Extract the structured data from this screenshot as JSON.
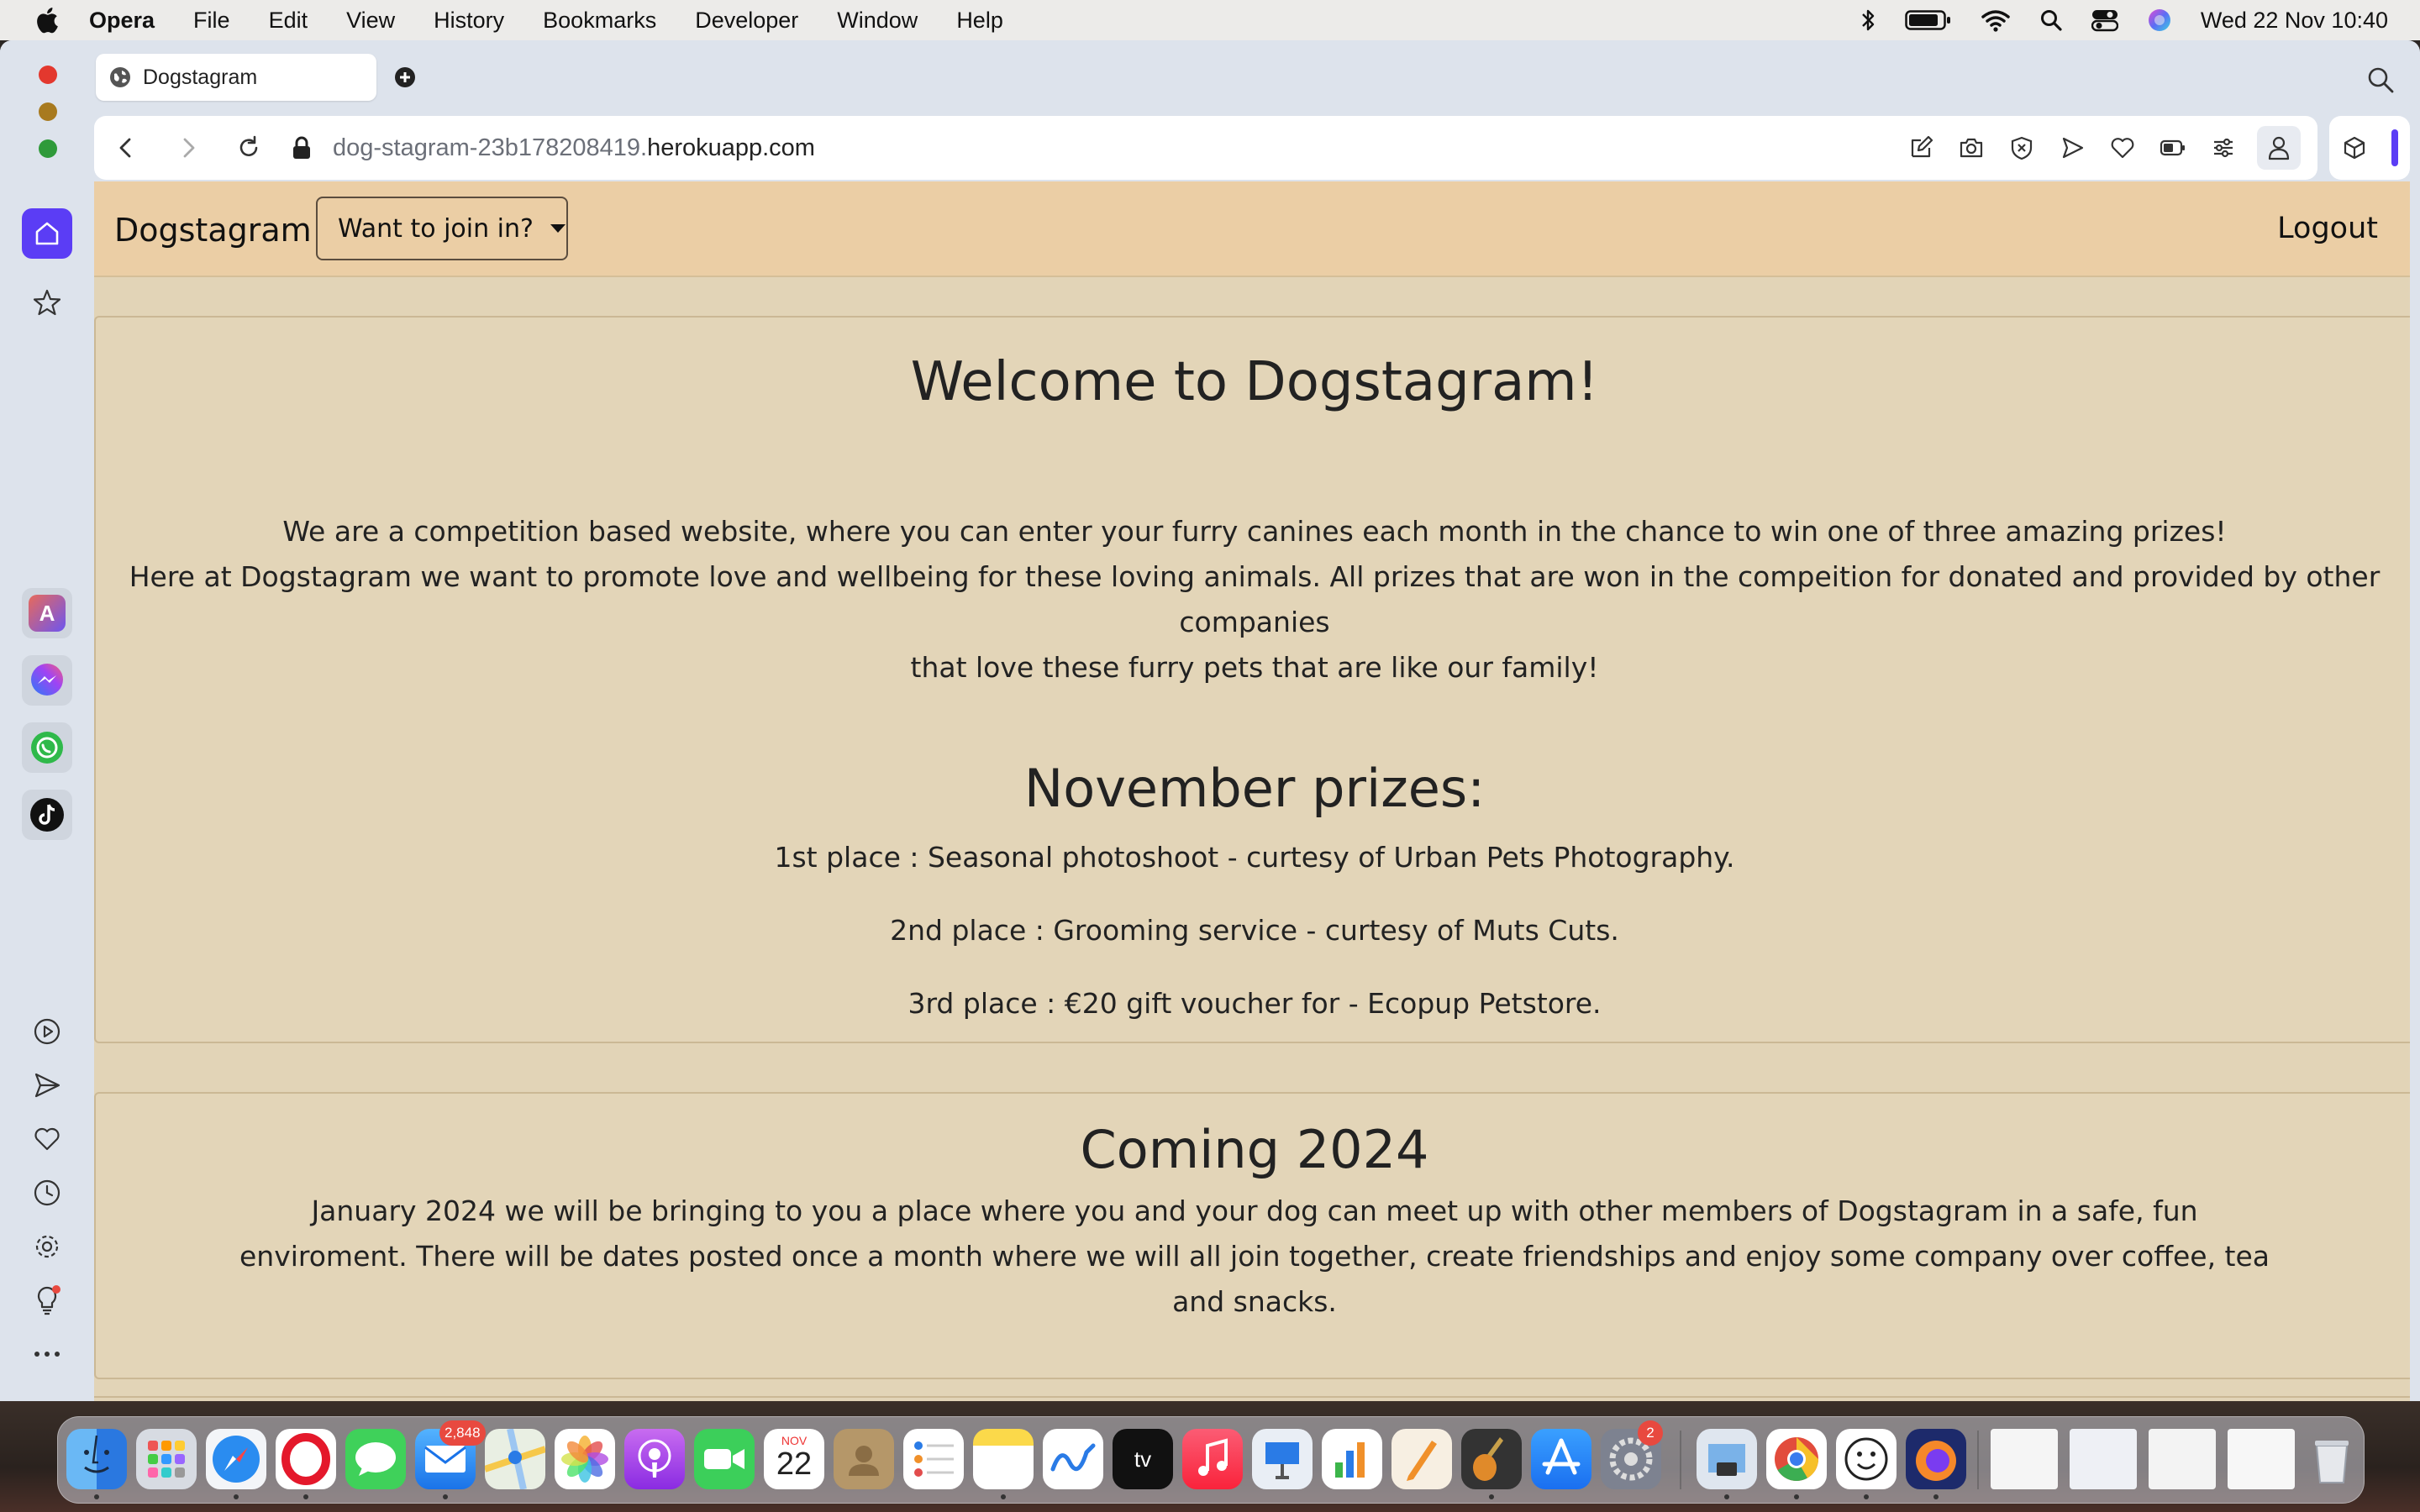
{
  "menubar": {
    "app_name": "Opera",
    "items": [
      "File",
      "Edit",
      "View",
      "History",
      "Bookmarks",
      "Developer",
      "Window",
      "Help"
    ],
    "clock": "Wed 22 Nov  10:40",
    "status_icons": [
      "bluetooth-icon",
      "battery-icon",
      "wifi-icon",
      "spotlight-icon",
      "control-center-icon",
      "siri-icon"
    ]
  },
  "browser": {
    "tab": {
      "title": "Dogstagram"
    },
    "address": {
      "url_prefix": "dog-stagram-23b178208419.",
      "url_domain": "herokuapp.com"
    },
    "toolbar_icons": [
      "easy-setup-icon",
      "snapshot-icon",
      "adblock-icon",
      "flow-icon",
      "bookmark-heart-icon",
      "battery-saver-icon",
      "easy-setup-sliders-icon",
      "profile-icon"
    ],
    "sidebar_apps": [
      "aria-icon",
      "messenger-icon",
      "whatsapp-icon",
      "tiktok-icon"
    ],
    "sidebar_bottom": [
      "player-icon",
      "send-icon",
      "heart-icon",
      "history-icon",
      "settings-icon",
      "lightbulb-icon",
      "more-icon"
    ],
    "accent_color": "#5b3df5"
  },
  "site": {
    "brand": "Dogstagram",
    "join_dropdown": "Want to join in?",
    "logout": "Logout",
    "colors": {
      "nav": "#ebcea5",
      "background": "#e2d4b7"
    },
    "welcome": {
      "title": "Welcome to Dogstagram!",
      "line1": "We are a competition based website, where you can enter your furry canines each month in the chance to win one of three amazing prizes!",
      "line2": "Here at Dogstagram we want to promote love and wellbeing for these loving animals. All prizes that are won in the compeition for donated and provided by other companies",
      "line3": "that love these furry pets that are like our family!"
    },
    "prizes": {
      "title": "November prizes:",
      "first": "1st place : Seasonal photoshoot - curtesy of Urban Pets Photography.",
      "second": "2nd place : Grooming service - curtesy of Muts Cuts.",
      "third": "3rd place : €20 gift voucher for - Ecopup Petstore."
    },
    "coming": {
      "title": "Coming 2024",
      "line1": "January 2024 we will be bringing to you a place where you and your dog can meet up with other members of Dogstagram in a safe, fun",
      "line2": "enviroment. There will be dates posted once a month where we will all join together, create friendships and enjoy some company over coffee, tea",
      "line3": "and snacks."
    }
  },
  "dock": {
    "mail_badge": "2,848",
    "settings_badge": "2",
    "calendar": {
      "month": "NOV",
      "day": "22"
    },
    "apps": [
      "finder",
      "launchpad",
      "safari",
      "opera",
      "messages",
      "mail",
      "maps",
      "photos",
      "podcasts",
      "facetime",
      "calendar",
      "contacts",
      "reminders",
      "notes",
      "freeform",
      "tv",
      "music",
      "keynote",
      "numbers",
      "pages",
      "garageband",
      "app-store",
      "system-settings",
      "preview",
      "chrome",
      "face-app",
      "firefox",
      "recent-1",
      "recent-2",
      "recent-3",
      "recent-4",
      "trash"
    ]
  }
}
